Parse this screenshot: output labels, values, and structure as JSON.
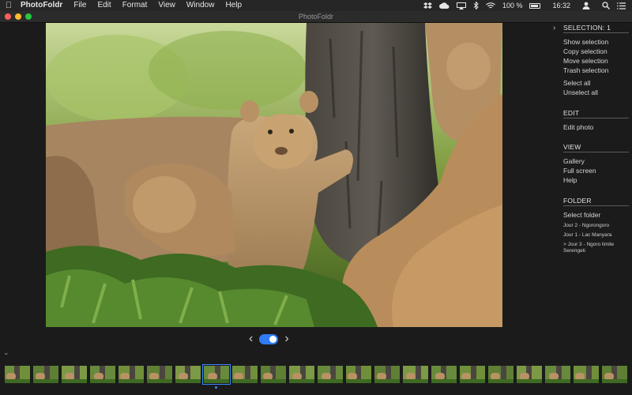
{
  "menubar": {
    "app_name": "PhotoFoldr",
    "menus": [
      "File",
      "Edit",
      "Format",
      "View",
      "Window",
      "Help"
    ],
    "battery_percent": "100 %",
    "clock": "16:32",
    "status_icons": [
      "dropbox-icon",
      "cloud-icon",
      "airplay-icon",
      "bluetooth-icon",
      "wifi-icon",
      "battery-icon",
      "user-icon",
      "search-icon",
      "list-icon"
    ]
  },
  "window": {
    "title": "PhotoFoldr"
  },
  "panel": {
    "selection": {
      "heading": "SELECTION: 1",
      "items": [
        "Show selection",
        "Copy selection",
        "Move selection",
        "Trash selection"
      ],
      "items2": [
        "Select all",
        "Unselect all"
      ]
    },
    "edit": {
      "heading": "EDIT",
      "items": [
        "Edit photo"
      ]
    },
    "view": {
      "heading": "VIEW",
      "items": [
        "Gallery",
        "Full screen",
        "Help"
      ]
    },
    "folder": {
      "heading": "FOLDER",
      "select_label": "Select folder",
      "folders": [
        "Jour 2 - Ngorongoro",
        "Jour 1 - Lac Manyara",
        "> Jour 3 - Ngoro limite Serengeti"
      ]
    }
  },
  "pager": {
    "prev": "‹",
    "next": "›",
    "toggle_on": true
  },
  "filmstrip": {
    "count": 22,
    "selected_index": 7
  },
  "colors": {
    "accent": "#2f7cf6",
    "background": "#1b1b1b"
  }
}
